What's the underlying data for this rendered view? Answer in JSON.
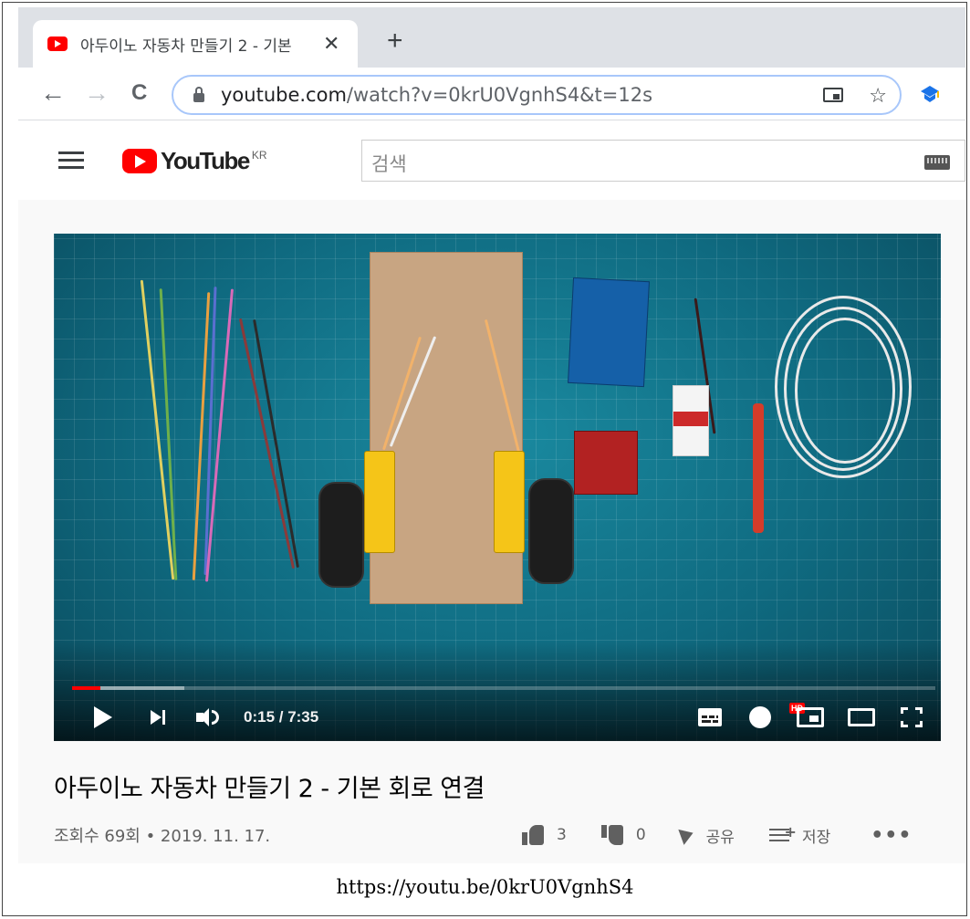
{
  "browser": {
    "tab_title": "아두이노 자동차 만들기 2 - 기본",
    "tab_close": "✕",
    "new_tab": "+",
    "url_host": "youtube.com",
    "url_path": "/watch?v=0krU0VgnhS4&t=12s",
    "back": "←",
    "forward": "→",
    "reload": "C",
    "star": "☆"
  },
  "youtube": {
    "logo_text": "YouTube",
    "region": "KR",
    "search_placeholder": "검색"
  },
  "player": {
    "time": "0:15 / 7:35",
    "progress_played": 0.033,
    "progress_buffered": 0.13,
    "hd_badge": "HD"
  },
  "video": {
    "title": "아두이노 자동차 만들기 2 - 기본 회로 연결",
    "meta": "조회수 69회 • 2019. 11. 17.",
    "likes": "3",
    "dislikes": "0",
    "share_label": "공유",
    "save_label": "저장",
    "more": "•••"
  },
  "caption": "https://youtu.be/0krU0VgnhS4",
  "colors": {
    "youtube_red": "#ff0000",
    "mat": "#0f6a80"
  }
}
